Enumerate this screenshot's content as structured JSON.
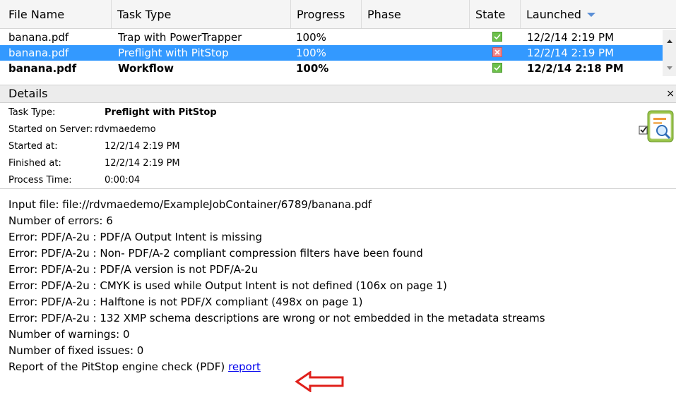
{
  "table": {
    "columns": {
      "file_name": "File Name",
      "task_type": "Task Type",
      "progress": "Progress",
      "phase": "Phase",
      "state": "State",
      "launched": "Launched"
    },
    "rows": [
      {
        "file": "banana.pdf",
        "task": "Trap with PowerTrapper",
        "progress": "100%",
        "phase": "",
        "state": "success",
        "launched": "12/2/14 2:19 PM"
      },
      {
        "file": "banana.pdf",
        "task": "Preflight with PitStop",
        "progress": "100%",
        "phase": "",
        "state": "error",
        "launched": "12/2/14 2:19 PM"
      },
      {
        "file": "banana.pdf",
        "task": "Workflow",
        "progress": "100%",
        "phase": "",
        "state": "success",
        "launched": "12/2/14 2:18 PM"
      }
    ]
  },
  "details": {
    "title": "Details",
    "close_glyph": "×",
    "properties": {
      "task_type_label": "Task Type:",
      "task_type_value": "Preflight with PitStop",
      "started_server_label": "Started on Server:",
      "started_server_value": "rdvmaedemo",
      "started_at_label": "Started at:",
      "started_at_value": "12/2/14 2:19 PM",
      "finished_at_label": "Finished at:",
      "finished_at_value": "12/2/14 2:19 PM",
      "process_time_label": "Process Time:",
      "process_time_value": "0:00:04"
    },
    "icon": "preflight-report-icon",
    "log": [
      "Input file: file://rdvmaedemo/ExampleJobContainer/6789/banana.pdf",
      "Number of errors: 6",
      "Error: PDF/A-2u : PDF/A Output Intent is missing",
      "Error: PDF/A-2u : Non- PDF/A-2 compliant compression filters have been found",
      "Error: PDF/A-2u : PDF/A version is not PDF/A-2u",
      "Error: PDF/A-2u : CMYK is used while Output Intent is not defined (106x on page 1)",
      "Error: PDF/A-2u : Halftone is not PDF/X compliant (498x on page 1)",
      "Error: PDF/A-2u : 132 XMP schema descriptions are wrong or not embedded in the metadata streams",
      "Number of warnings: 0",
      "Number of fixed issues: 0"
    ],
    "report_prefix": "Report of the PitStop engine check (PDF)",
    "report_link": "report"
  },
  "colors": {
    "selection": "#3399ff",
    "state_success": "#6cc04a",
    "state_error": "#f2878a",
    "annotation_arrow": "#e0201b",
    "link": "#0000ee"
  }
}
